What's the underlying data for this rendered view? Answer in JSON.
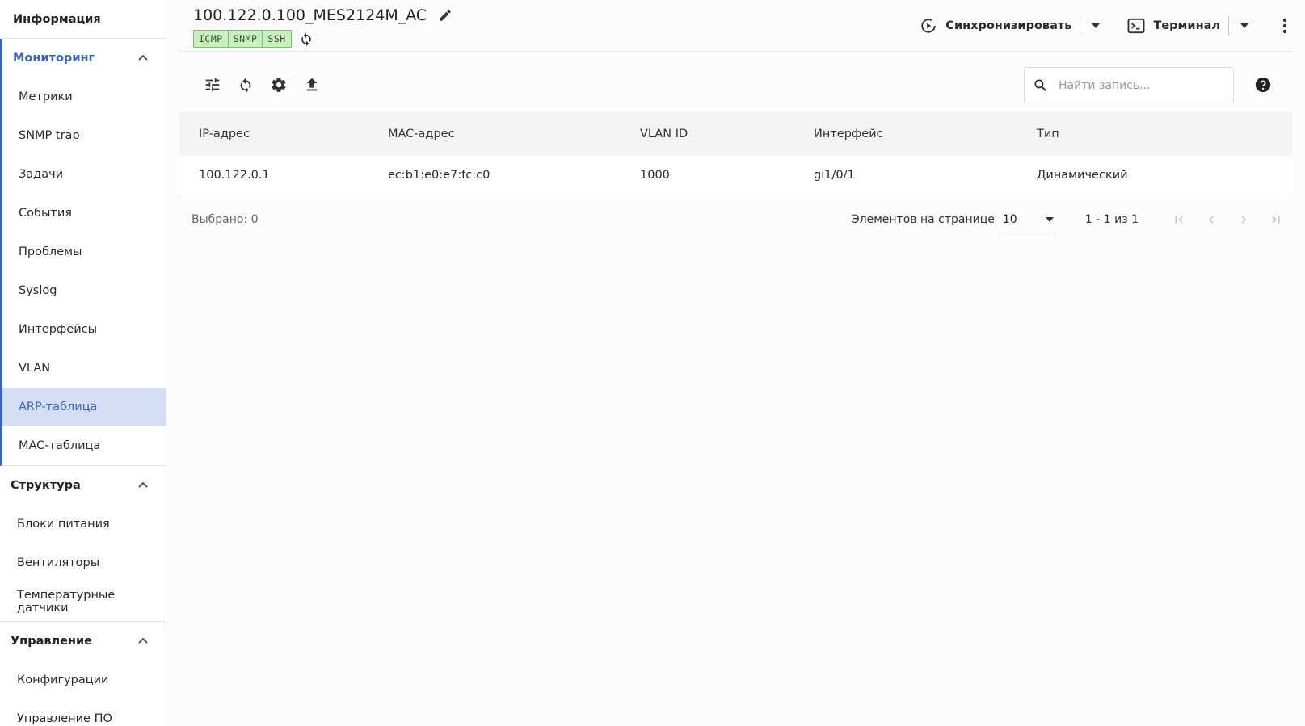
{
  "sidebar": {
    "top_item": "Информация",
    "sections": [
      {
        "title": "Мониторинг",
        "items": [
          "Метрики",
          "SNMP trap",
          "Задачи",
          "События",
          "Проблемы",
          "Syslog",
          "Интерфейсы",
          "VLAN",
          "ARP-таблица",
          "MAC-таблица"
        ]
      },
      {
        "title": "Структура",
        "items": [
          "Блоки питания",
          "Вентиляторы",
          "Температурные датчики"
        ]
      },
      {
        "title": "Управление",
        "items": [
          "Конфигурации",
          "Управление ПО"
        ]
      }
    ],
    "selected_item": "ARP-таблица"
  },
  "header": {
    "device_name": "100.122.0.100_MES2124M_AC",
    "badges": [
      "ICMP",
      "SNMP",
      "SSH"
    ],
    "sync_label": "Синхронизировать",
    "terminal_label": "Терминал"
  },
  "toolbar": {
    "search_placeholder": "Найти запись..."
  },
  "table": {
    "columns": [
      "IP-адрес",
      "MAC-адрес",
      "VLAN ID",
      "Интерфейс",
      "Тип"
    ],
    "rows": [
      [
        "100.122.0.1",
        "ec:b1:e0:e7:fc:c0",
        "1000",
        "gi1/0/1",
        "Динамический"
      ]
    ]
  },
  "footer": {
    "selected": "Выбрано: 0",
    "per_page_label": "Элементов на странице",
    "per_page_value": "10",
    "range": "1 - 1 из 1"
  },
  "colors": {
    "accent": "#3a64b8",
    "selected_bg": "#d4def2",
    "badge_bg": "#c9efc1"
  }
}
